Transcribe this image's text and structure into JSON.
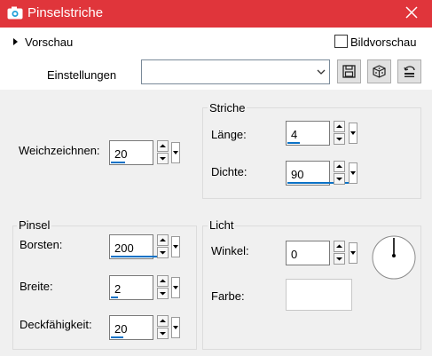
{
  "window": {
    "title": "Pinselstriche"
  },
  "toolbar": {
    "preview_label": "Vorschau",
    "bildvorschau_label": "Bildvorschau",
    "einstellungen_label": "Einstellungen",
    "einstellungen_value": ""
  },
  "weichzeichnen": {
    "label": "Weichzeichnen:",
    "value": "20"
  },
  "striche": {
    "title": "Striche",
    "laenge": {
      "label": "Länge:",
      "value": "4"
    },
    "dichte": {
      "label": "Dichte:",
      "value": "90"
    }
  },
  "pinsel": {
    "title": "Pinsel",
    "borsten": {
      "label": "Borsten:",
      "value": "200"
    },
    "breite": {
      "label": "Breite:",
      "value": "2"
    },
    "deckfaehigkeit": {
      "label": "Deckfähigkeit:",
      "value": "20"
    }
  },
  "licht": {
    "title": "Licht",
    "winkel": {
      "label": "Winkel:",
      "value": "0"
    },
    "farbe": {
      "label": "Farbe:",
      "color": "#ffffff"
    }
  },
  "colors": {
    "titlebar": "#e0353b",
    "accent": "#0b72c6"
  }
}
